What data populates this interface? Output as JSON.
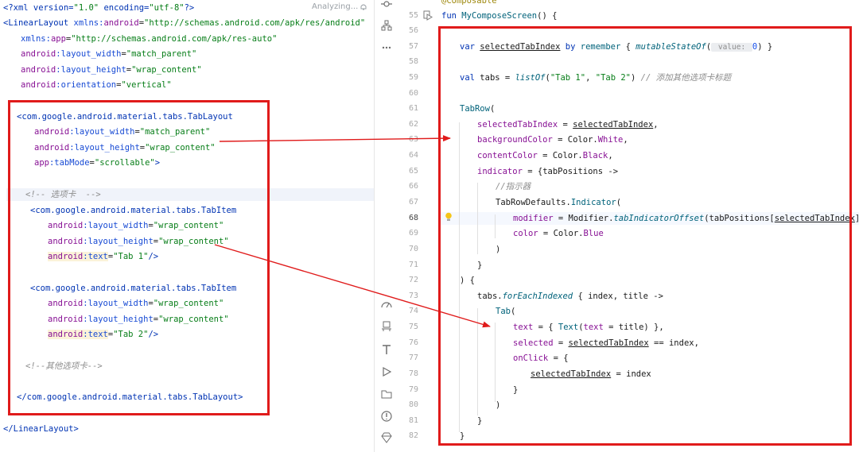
{
  "status": {
    "analyzing": "Analyzing..."
  },
  "xml": {
    "l1": {
      "a": "<?xml version=",
      "b": "\"1.0\"",
      "c": " encoding=",
      "d": "\"utf-8\"",
      "e": "?>"
    },
    "l2": {
      "a": "<LinearLayout ",
      "b": "xmlns:",
      "c": "android",
      "d": "=",
      "e": "\"http://schemas.android.com/apk/res/android\""
    },
    "l3": {
      "a": "xmlns:",
      "b": "app",
      "c": "=",
      "d": "\"http://schemas.android.com/apk/res-auto\""
    },
    "l4": {
      "a": "android",
      "b": ":layout_width",
      "c": "=",
      "d": "\"match_parent\""
    },
    "l5": {
      "a": "android",
      "b": ":layout_height",
      "c": "=",
      "d": "\"wrap_content\""
    },
    "l6": {
      "a": "android",
      "b": ":orientation",
      "c": "=",
      "d": "\"vertical\""
    },
    "l7": {
      "a": "<com.google.android.material.tabs.TabLayout"
    },
    "l8": {
      "a": "android",
      "b": ":layout_width",
      "c": "=",
      "d": "\"match_parent\""
    },
    "l9": {
      "a": "android",
      "b": ":layout_height",
      "c": "=",
      "d": "\"wrap_content\""
    },
    "l10": {
      "a": "app",
      "b": ":tabMode",
      "c": "=",
      "d": "\"scrollable\"",
      "e": ">"
    },
    "l11": {
      "a": "<!-- 选项卡  -->"
    },
    "l12": {
      "a": "<com.google.android.material.tabs.TabItem"
    },
    "l13": {
      "a": "android",
      "b": ":layout_width",
      "c": "=",
      "d": "\"wrap_content\""
    },
    "l14": {
      "a": "android",
      "b": ":layout_height",
      "c": "=",
      "d": "\"wrap_content\""
    },
    "l15": {
      "a": "android",
      "b": ":text",
      "c": "=",
      "d": "\"Tab 1\"",
      "e": "/>"
    },
    "l16": {
      "a": "<com.google.android.material.tabs.TabItem"
    },
    "l17": {
      "a": "android",
      "b": ":layout_width",
      "c": "=",
      "d": "\"wrap_content\""
    },
    "l18": {
      "a": "android",
      "b": ":layout_height",
      "c": "=",
      "d": "\"wrap_content\""
    },
    "l19": {
      "a": "android",
      "b": ":text",
      "c": "=",
      "d": "\"Tab 2\"",
      "e": "/>"
    },
    "l20": {
      "a": "<!--其他选项卡-->"
    },
    "l21": {
      "a": "</com.google.android.material.tabs.TabLayout>"
    },
    "l22": {
      "a": "</LinearLayout>"
    }
  },
  "gutter": {
    "lines": [
      "55",
      "56",
      "57",
      "58",
      "59",
      "60",
      "61",
      "62",
      "63",
      "64",
      "65",
      "66",
      "67",
      "68",
      "69",
      "70",
      "71",
      "72",
      "73",
      "74",
      "75",
      "76",
      "77",
      "78",
      "79",
      "80",
      "81",
      "82"
    ]
  },
  "code": {
    "c0": "@Composable",
    "c55": {
      "a": "fun ",
      "b": "MyComposeScreen",
      "c": "() {"
    },
    "c57": {
      "a": "var ",
      "b": "selectedTabIndex",
      "c": " by ",
      "d": "remember",
      "e": " { ",
      "f": "mutableStateOf",
      "g": "(",
      "h": " value: ",
      "i": "0",
      "j": ") }"
    },
    "c59": {
      "a": "val ",
      "b": "tabs = ",
      "c": "listOf",
      "d": "(",
      "e": "\"Tab 1\"",
      "f": ", ",
      "g": "\"Tab 2\"",
      "h": ") ",
      "i": "// 添加其他选项卡标题"
    },
    "c61": {
      "a": "TabRow",
      "b": "("
    },
    "c62": {
      "a": "selectedTabIndex",
      "b": " = ",
      "c": "selectedTabIndex",
      "d": ","
    },
    "c63": {
      "a": "backgroundColor",
      "b": " = Color.",
      "c": "White",
      "d": ","
    },
    "c64": {
      "a": "contentColor",
      "b": " = Color.",
      "c": "Black",
      "d": ","
    },
    "c65": {
      "a": "indicator",
      "b": " = {tabPositions ->"
    },
    "c66": {
      "a": "//指示器"
    },
    "c67": {
      "a": "TabRowDefaults.",
      "b": "Indicator",
      "c": "("
    },
    "c68": {
      "a": "modifier",
      "b": " = Modifier.",
      "c": "tabIndicatorOffset",
      "d": "(tabPositions[",
      "e": "selectedTabIndex",
      "f": "]),"
    },
    "c69": {
      "a": "color",
      "b": " = Color.",
      "c": "Blue"
    },
    "c70": {
      "a": ")"
    },
    "c71": {
      "a": "}"
    },
    "c72": {
      "a": ") {"
    },
    "c73": {
      "a": "tabs.",
      "b": "forEachIndexed",
      "c": " { index, title ->"
    },
    "c74": {
      "a": "Tab",
      "b": "("
    },
    "c75": {
      "a": "text",
      "b": " = { ",
      "c": "Text",
      "d": "(",
      "e": "text",
      "f": " = title) },"
    },
    "c76": {
      "a": "selected",
      "b": " = ",
      "c": "selectedTabIndex",
      "d": " == index,"
    },
    "c77": {
      "a": "onClick",
      "b": " = {"
    },
    "c78": {
      "a": "selectedTabIndex",
      "b": " = index"
    },
    "c79": {
      "a": "}"
    },
    "c80": {
      "a": ")"
    },
    "c81": {
      "a": "}"
    },
    "c82": {
      "a": "}"
    }
  },
  "colors": {
    "annotation": "#e01b1b",
    "keyword": "#0033b3",
    "string": "#067d17",
    "comment": "#8c8c8c"
  },
  "icons": [
    "commit-icon",
    "structure-icon",
    "more-icon",
    "profiler-icon",
    "build-icon",
    "terminal-icon",
    "run-icon",
    "app-inspection-icon",
    "problems-icon",
    "gem-icon",
    "bell-icon",
    "lightbulb-icon",
    "run-gutter-icon"
  ]
}
